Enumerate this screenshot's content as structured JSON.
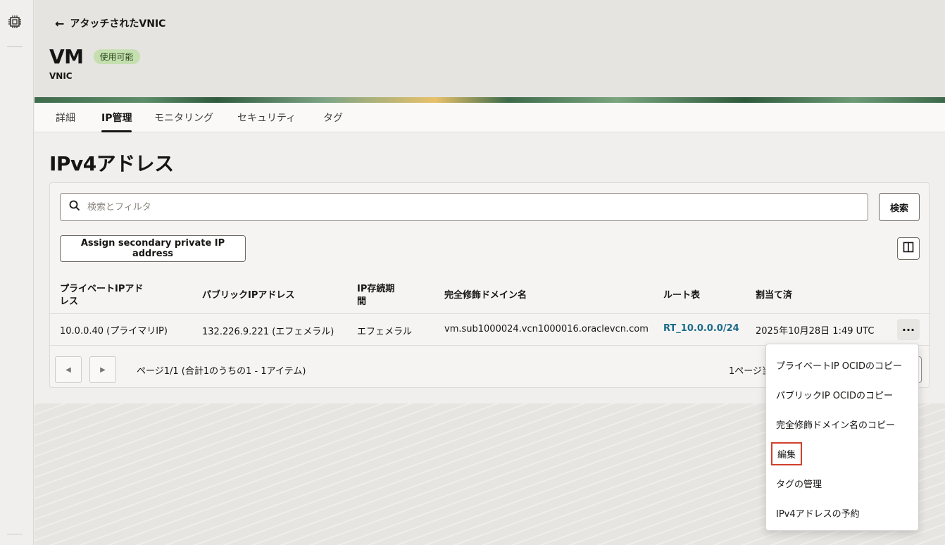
{
  "header": {
    "back_label": "アタッチされたVNIC",
    "title": "VM",
    "status_badge": "使用可能",
    "subtitle": "VNIC"
  },
  "tabs": [
    {
      "label": "詳細"
    },
    {
      "label": "IP管理"
    },
    {
      "label": "モニタリング"
    },
    {
      "label": "セキュリティ"
    },
    {
      "label": "タグ"
    }
  ],
  "active_tab": "IP管理",
  "section": {
    "title": "IPv4アドレス"
  },
  "search": {
    "placeholder": "検索とフィルタ",
    "button_label": "検索"
  },
  "actions": {
    "assign_label": "Assign secondary private IP address"
  },
  "table": {
    "headers": {
      "private_ip_line1": "プライベートIPアド",
      "private_ip_line2": "レス",
      "public_ip": "パブリックIPアドレス",
      "lifetime_line1": "IP存続期",
      "lifetime_line2": "間",
      "fqdn": "完全修飾ドメイン名",
      "route_table": "ルート表",
      "assigned": "割当て済"
    },
    "rows": [
      {
        "private_ip": "10.0.0.40 (プライマリIP)",
        "public_ip": "132.226.9.221 (エフェメラル)",
        "lifetime": "エフェメラル",
        "fqdn": "vm.sub1000024.vcn1000016.oraclevcn.com",
        "route_table": "RT_10.0.0.0/24",
        "assigned": "2025年10月28日 1:49 UTC"
      }
    ]
  },
  "pagination": {
    "summary": "ページ1/1 (合計1のうちの1 - 1アイテム)",
    "right_label": "1ページ当"
  },
  "row_menu": {
    "items": [
      {
        "label": "プライベートIP OCIDのコピー"
      },
      {
        "label": "パブリックIP OCIDのコピー"
      },
      {
        "label": "完全修飾ドメイン名のコピー"
      },
      {
        "label": "編集"
      },
      {
        "label": "タグの管理"
      },
      {
        "label": "IPv4アドレスの予約"
      }
    ],
    "highlighted": "編集"
  },
  "colors": {
    "accent_link": "#1a6a8a",
    "badge_bg": "#c5dfb0",
    "highlight_border": "#d0402a"
  }
}
